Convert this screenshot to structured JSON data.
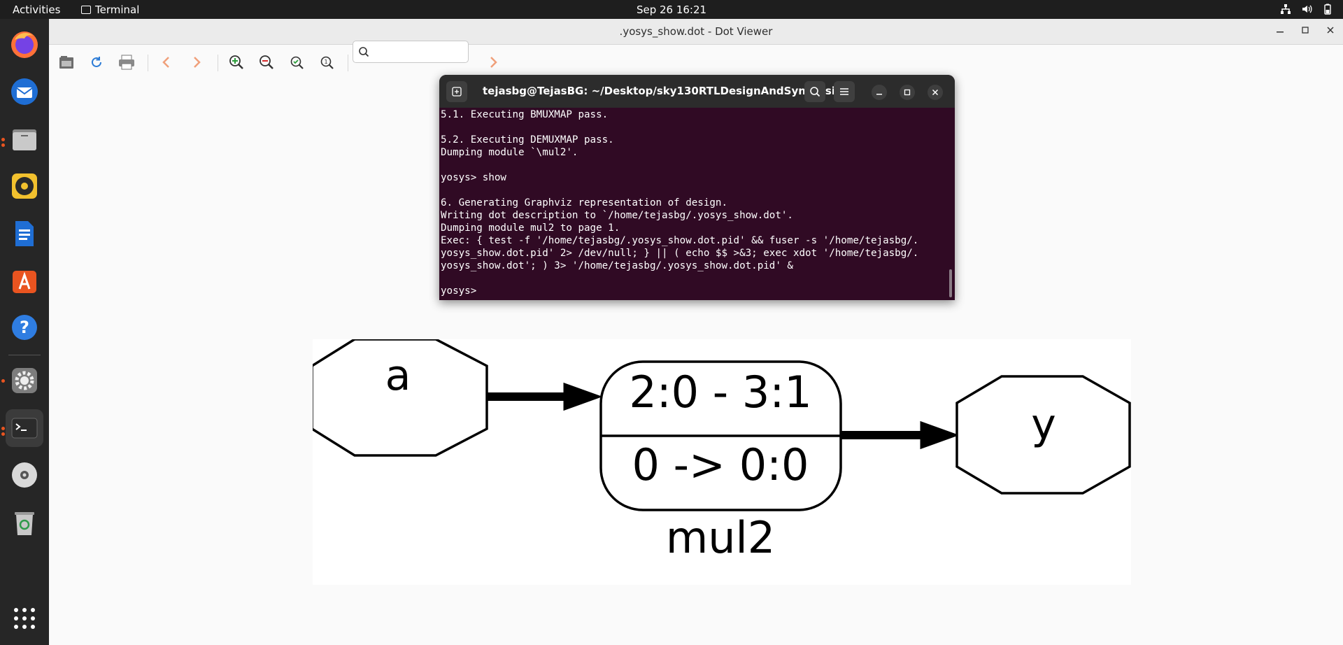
{
  "topbar": {
    "activities": "Activities",
    "app_name": "Terminal",
    "clock": "Sep 26  16:21"
  },
  "dock": {
    "items": [
      {
        "name": "firefox-icon"
      },
      {
        "name": "thunderbird-icon"
      },
      {
        "name": "files-icon"
      },
      {
        "name": "rhythmbox-icon"
      },
      {
        "name": "writer-icon"
      },
      {
        "name": "app-center-icon"
      },
      {
        "name": "help-icon"
      },
      {
        "name": "settings-icon"
      },
      {
        "name": "terminal-icon"
      },
      {
        "name": "disc-icon"
      },
      {
        "name": "trash-icon"
      },
      {
        "name": "show-apps-icon"
      }
    ]
  },
  "viewer": {
    "title": ".yosys_show.dot - Dot Viewer",
    "search_value": ""
  },
  "terminal": {
    "title": "tejasbg@TejasBG: ~/Desktop/sky130RTLDesignAndSynthesis...",
    "lines": [
      "5.1. Executing BMUXMAP pass.",
      "",
      "5.2. Executing DEMUXMAP pass.",
      "Dumping module `\\mul2'.",
      "",
      "yosys> show",
      "",
      "6. Generating Graphviz representation of design.",
      "Writing dot description to `/home/tejasbg/.yosys_show.dot'.",
      "Dumping module mul2 to page 1.",
      "Exec: { test -f '/home/tejasbg/.yosys_show.dot.pid' && fuser -s '/home/tejasbg/.",
      "yosys_show.dot.pid' 2> /dev/null; } || ( echo $$ >&3; exec xdot '/home/tejasbg/.",
      "yosys_show.dot'; ) 3> '/home/tejasbg/.yosys_show.dot.pid' &",
      "",
      "yosys> "
    ]
  },
  "graph": {
    "input_node": "a",
    "cell_top": "2:0 - 3:1",
    "cell_bottom": "0 -> 0:0",
    "output_node": "y",
    "module_label": "mul2"
  },
  "colors": {
    "terminal_bg": "#300a24",
    "ubuntu_orange": "#e95420",
    "topbar_bg": "#1e1e1e",
    "dock_bg": "#262626"
  }
}
